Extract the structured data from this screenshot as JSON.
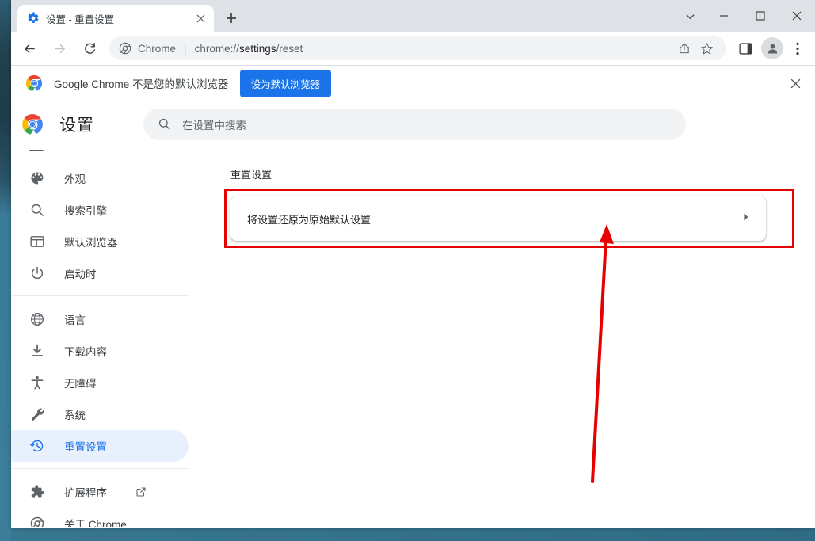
{
  "window": {
    "controls": {
      "tab_search": "tab-search",
      "minimize": "minimize",
      "maximize": "maximize",
      "close": "close"
    }
  },
  "tabstrip": {
    "tabs": [
      {
        "title": "设置 - 重置设置",
        "favicon": "gear-icon",
        "close_label": "×"
      }
    ],
    "new_tab_label": "+"
  },
  "toolbar": {
    "back": "back-arrow",
    "forward": "forward-arrow",
    "reload": "reload",
    "omnibox": {
      "chip": "Chrome",
      "separator": "|",
      "url_prefix": "chrome://",
      "url_bold": "settings",
      "url_suffix": "/reset",
      "full_url": "chrome://settings/reset"
    },
    "share": "share-icon",
    "bookmark": "star-icon",
    "side_panel": "side-panel-icon",
    "profile": "avatar",
    "menu": "three-dot-menu"
  },
  "infobar": {
    "text": "Google Chrome 不是您的默认浏览器",
    "button_label": "设为默认浏览器",
    "close_label": "×",
    "button_color": "#1a73e8"
  },
  "settings": {
    "title": "设置",
    "search": {
      "placeholder": "在设置中搜索",
      "value": ""
    },
    "sidebar": {
      "groups": [
        {
          "items": [
            {
              "label": "外观",
              "icon": "palette-icon",
              "selected": false
            },
            {
              "label": "搜索引擎",
              "icon": "search-icon",
              "selected": false
            },
            {
              "label": "默认浏览器",
              "icon": "browser-window-icon",
              "selected": false
            },
            {
              "label": "启动时",
              "icon": "power-icon",
              "selected": false
            }
          ]
        },
        {
          "items": [
            {
              "label": "语言",
              "icon": "globe-icon",
              "selected": false
            },
            {
              "label": "下载内容",
              "icon": "download-icon",
              "selected": false
            },
            {
              "label": "无障碍",
              "icon": "accessibility-icon",
              "selected": false
            },
            {
              "label": "系统",
              "icon": "wrench-icon",
              "selected": false
            },
            {
              "label": "重置设置",
              "icon": "restore-history-icon",
              "selected": true
            }
          ]
        },
        {
          "items": [
            {
              "label": "扩展程序",
              "icon": "puzzle-icon",
              "selected": false,
              "external": true
            },
            {
              "label": "关于 Chrome",
              "icon": "chrome-outline-icon",
              "selected": false
            }
          ]
        }
      ],
      "selected_color": "#1a73e8",
      "selected_bg": "#e8f0fe"
    },
    "content": {
      "section_title": "重置设置",
      "cards": [
        {
          "label": "将设置还原为原始默认设置",
          "arrow": "chevron-right"
        }
      ]
    }
  },
  "annotation": {
    "color": "#e60000",
    "box_target": "将设置还原为原始默认设置",
    "arrow_direction": "up"
  }
}
